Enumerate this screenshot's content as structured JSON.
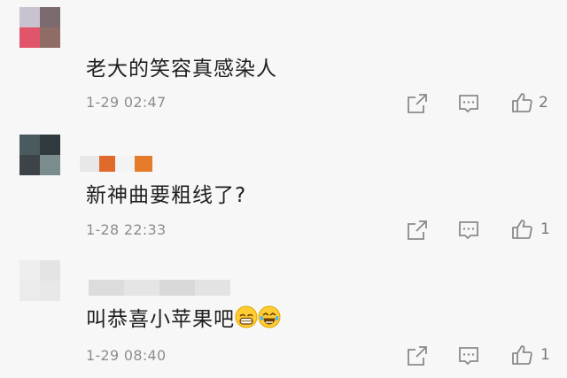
{
  "comments": [
    {
      "text": "老大的笑容真感染人",
      "time": "1-29 02:47",
      "likes": "2",
      "avatar_colors": [
        "#c9c3d1",
        "#7c6b6e",
        "#e0556a",
        "#8f6c66"
      ],
      "name_blur_colors": []
    },
    {
      "text": "新神曲要粗线了?",
      "time": "1-28 22:33",
      "likes": "1",
      "avatar_colors": [
        "#4b5a5f",
        "#2f3a3e",
        "#3d4346",
        "#7b8c8c"
      ],
      "name_blur_colors": [
        "#e8e8e8",
        "#e06a2c",
        "#f3f3f3",
        "#e57a2a"
      ]
    },
    {
      "text": "叫恭喜小苹果吧",
      "time": "1-29 08:40",
      "likes": "1",
      "avatar_colors": [
        "#eeeeee",
        "#e4e4e4",
        "#ebebeb",
        "#e8e8e8"
      ],
      "name_blur_colors": [
        "#dcdcdc",
        "#e5e5e5",
        "#d9d9d9",
        "#e3e3e3"
      ]
    }
  ],
  "icons": {
    "share": "share-icon",
    "reply": "comment-icon",
    "like": "thumbs-up-icon",
    "emoji_1": "grinning-face-emoji",
    "emoji_2": "tears-of-joy-emoji"
  },
  "colors": {
    "background": "#f7f7f7",
    "text": "#1e1e1e",
    "meta": "#8d8d8d",
    "icon": "#8a8a8a"
  }
}
